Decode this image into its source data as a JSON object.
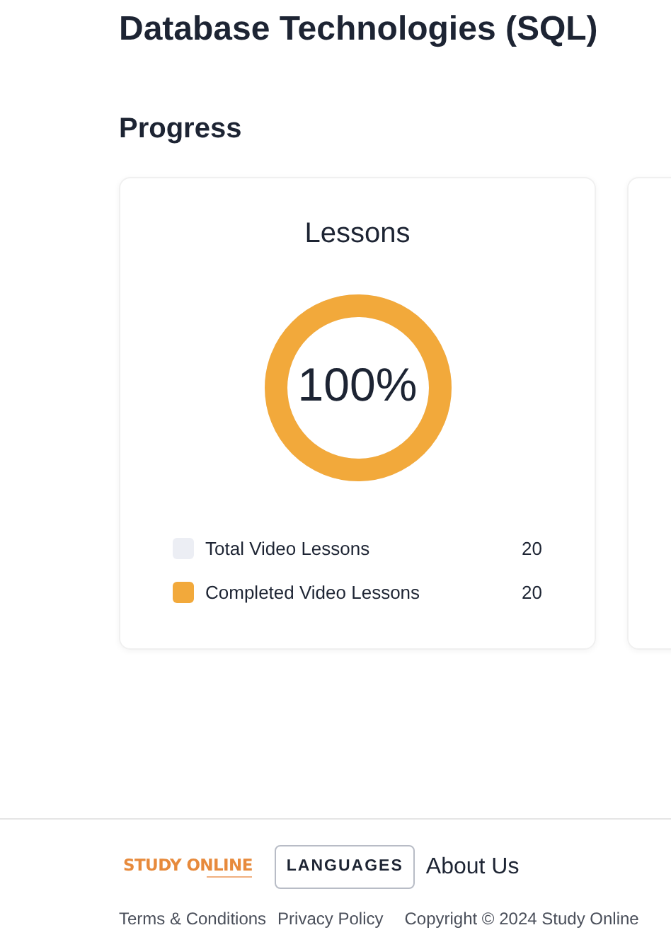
{
  "page_title": "Database Technologies (SQL)",
  "section_title": "Progress",
  "progress_card": {
    "title": "Lessons",
    "level": 1,
    "percent": "100%",
    "legend": [
      {
        "label": "Total Video Lessons",
        "value": "20",
        "color": "#eceef4"
      },
      {
        "label": "Completed Video Lessons",
        "value": "20",
        "color": "#f2a93b"
      }
    ]
  },
  "footer": {
    "logo": "STUDY ONLINE",
    "languages_button": "LANGUAGES",
    "nav_link": "About Us",
    "links": [
      "Terms & Conditions",
      "Privacy Policy"
    ],
    "copyright": "Copyright © 2024 Study Online"
  }
}
